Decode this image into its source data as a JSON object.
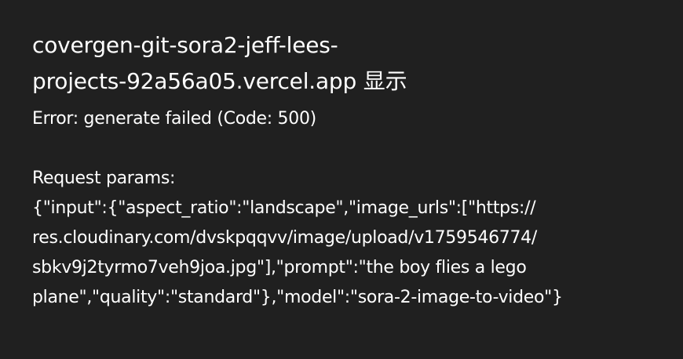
{
  "dialog": {
    "title_line1": "covergen-git-sora2-jeff-lees-",
    "title_line2": "projects-92a56a05.vercel.app 显示",
    "error_line": "Error: generate failed (Code: 500)",
    "params_label": "Request params:",
    "params_lines": [
      "{\"input\":{\"aspect_ratio\":\"landscape\",\"image_urls\":[\"https://",
      "res.cloudinary.com/dvskpqqvv/image/upload/v1759546774/",
      "sbkv9j2tyrmo7veh9joa.jpg\"],\"prompt\":\"the boy flies a lego",
      "plane\",\"quality\":\"standard\"},\"model\":\"sora-2-image-to-video\"}"
    ]
  }
}
